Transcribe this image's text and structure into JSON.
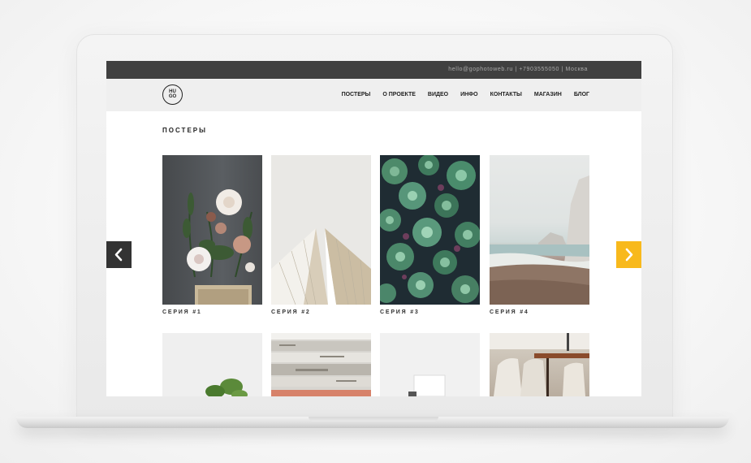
{
  "topbar": {
    "email": "hello@gophotoweb.ru",
    "phone": "+7903555050",
    "city": "Москва",
    "separator": "|"
  },
  "logo": {
    "line1": "HU",
    "line2": "GO"
  },
  "nav": {
    "items": [
      "ПОСТЕРЫ",
      "О ПРОЕКТЕ",
      "ВИДЕО",
      "ИНФО",
      "КОНТАКТЫ",
      "МАГАЗИН",
      "БЛОГ"
    ]
  },
  "page": {
    "title": "ПОСТЕРЫ"
  },
  "gallery": {
    "row1": [
      {
        "label": "СЕРИЯ #1",
        "image": "flowers-bouquet"
      },
      {
        "label": "СЕРИЯ #2",
        "image": "architecture-roof"
      },
      {
        "label": "СЕРИЯ #3",
        "image": "succulents"
      },
      {
        "label": "СЕРИЯ #4",
        "image": "beach-cliffs"
      }
    ],
    "row2": [
      {
        "image": "plant-leaves"
      },
      {
        "image": "weathered-wood"
      },
      {
        "image": "white-still-life"
      },
      {
        "image": "dining-chairs"
      }
    ]
  },
  "colors": {
    "topbar_bg": "#404040",
    "navbar_bg": "#efefef",
    "arrow_prev_bg": "#333333",
    "arrow_next_bg": "#f8b91c"
  },
  "icons": {
    "prev": "chevron-left-icon",
    "next": "chevron-right-icon"
  }
}
